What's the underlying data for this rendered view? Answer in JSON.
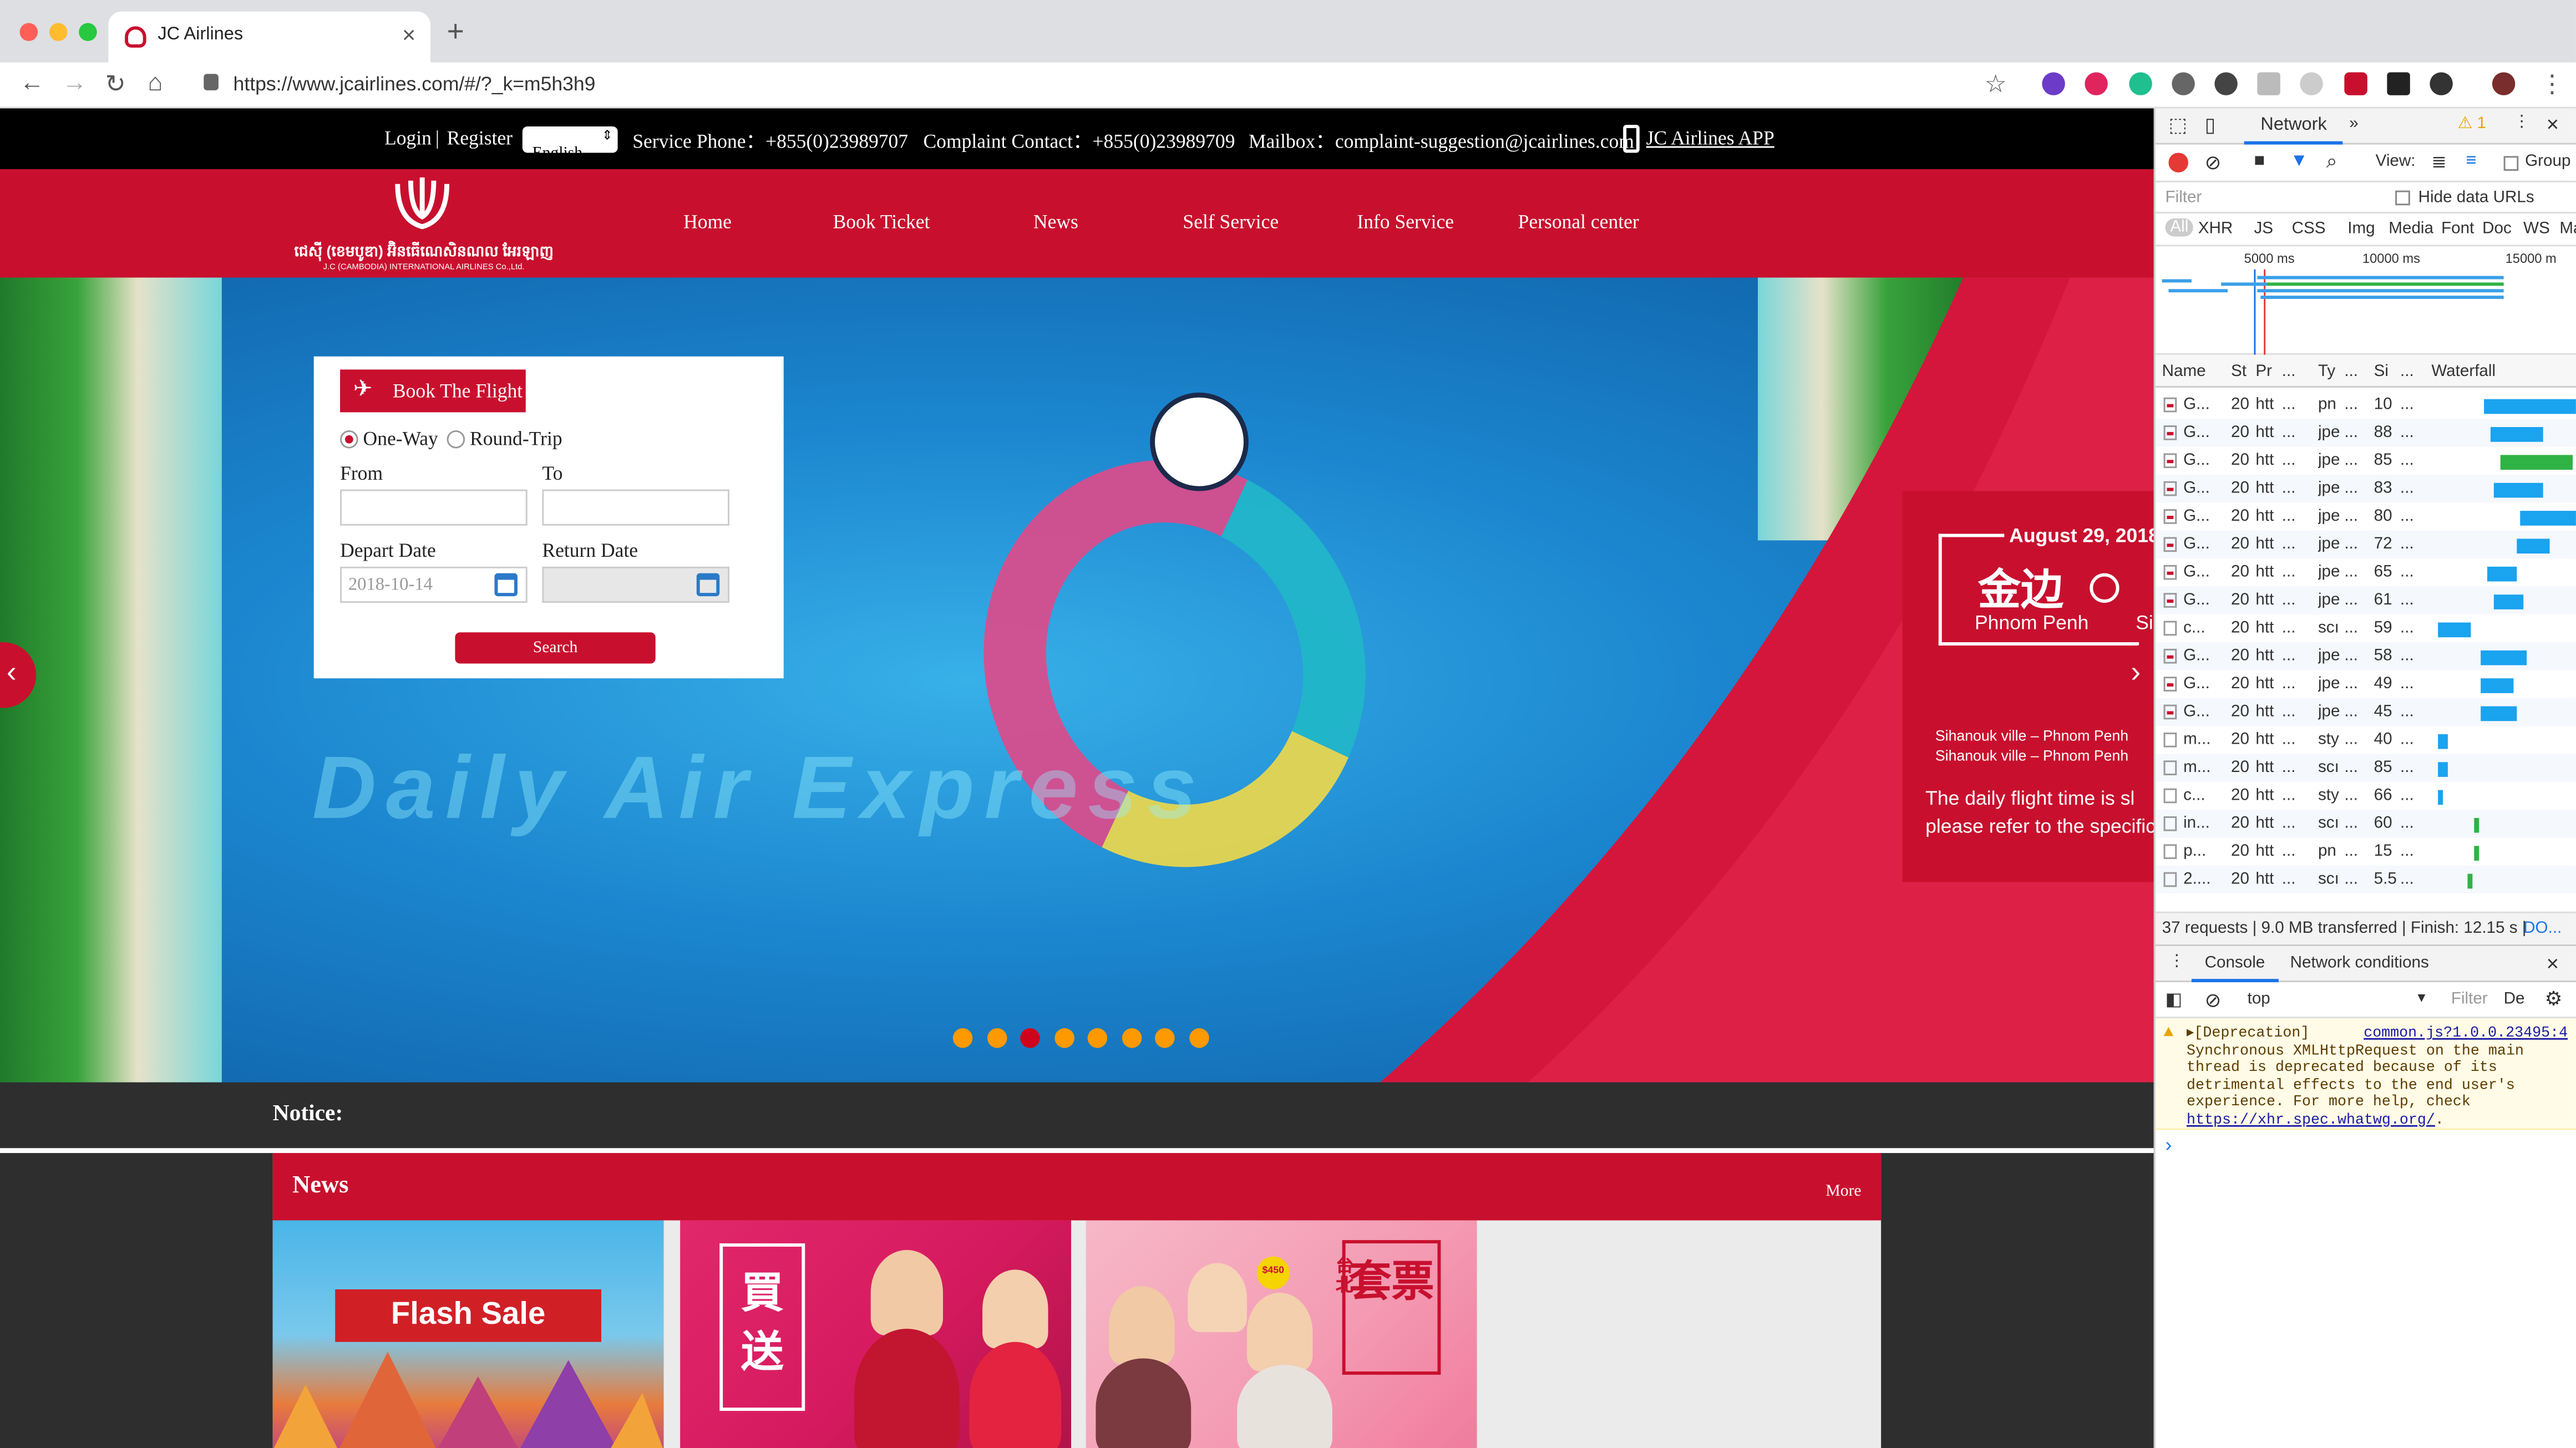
{
  "browser": {
    "tab_title": "JC Airlines",
    "url": "https://www.jcairlines.com/#/?_k=m5h3h9"
  },
  "topbar": {
    "login": "Login",
    "separator": "|",
    "register": "Register",
    "language": "English",
    "service_phone": "Service Phone：+855(0)23989707",
    "complaint_contact": "Complaint Contact：+855(0)23989709",
    "mailbox": "Mailbox：complaint-suggestion@jcairlines.com",
    "app_link": "JC Airlines APP"
  },
  "logo": {
    "khmer_text": "ជេស៊ី (ខេមបូឌា) អ៊ិនធើណេសិនណល អែរឡាញ",
    "subtitle": "J.C (CAMBODIA) INTERNATIONAL AIRLINES Co.,Ltd."
  },
  "nav": [
    "Home",
    "Book Ticket",
    "News",
    "Self Service",
    "Info Service",
    "Personal center"
  ],
  "booking": {
    "tab_label": "Book The Flight",
    "one_way": "One-Way",
    "round_trip": "Round-Trip",
    "from_label": "From",
    "to_label": "To",
    "depart_label": "Depart Date",
    "return_label": "Return Date",
    "depart_value": "2018-10-14",
    "search_label": "Search"
  },
  "banner": {
    "watermark": "Daily Air Express",
    "promo_date": "August 29, 2018",
    "promo_cn": "金边",
    "promo_city": "Phnom Penh",
    "promo_clip": "Si",
    "route1": "Sihanouk ville – Phnom Penh",
    "route2": "Sihanouk ville – Phnom Penh",
    "desc1": "The daily flight time is sl",
    "desc2": "please refer to the specific",
    "dots": 8,
    "active_dot": 2,
    "prev": "‹",
    "next": "›"
  },
  "notice": {
    "label": "Notice:"
  },
  "news": {
    "title": "News",
    "more": "More",
    "card1_text": "Flash Sale",
    "card2_text": "買送",
    "card3_text": "套票",
    "card3_side": "台北",
    "card3_tag": "$450"
  },
  "devtools": {
    "tab_network": "Network",
    "more_tabs": "»",
    "warn_count": "⚠ 1",
    "view_label": "View:",
    "group_label": "Group",
    "filter_placeholder": "Filter",
    "hide_data_urls": "Hide data URLs",
    "types": [
      "All",
      "XHR",
      "JS",
      "CSS",
      "Img",
      "Media",
      "Font",
      "Doc",
      "WS",
      "Man"
    ],
    "ticks": [
      "5000 ms",
      "10000 ms",
      "15000 m"
    ],
    "columns": [
      "Name",
      "St",
      "Pr",
      "...",
      "Ty",
      "...",
      "Si",
      "...",
      "Waterfall"
    ],
    "rows": [
      {
        "name": "G...",
        "st": "20",
        "pr": "htt",
        "ty": "pn",
        "si": "10",
        "img": true
      },
      {
        "name": "G...",
        "st": "20",
        "pr": "htt",
        "ty": "jpe",
        "si": "88",
        "img": true
      },
      {
        "name": "G...",
        "st": "20",
        "pr": "htt",
        "ty": "jpe",
        "si": "85",
        "img": true
      },
      {
        "name": "G...",
        "st": "20",
        "pr": "htt",
        "ty": "jpe",
        "si": "83",
        "img": true
      },
      {
        "name": "G...",
        "st": "20",
        "pr": "htt",
        "ty": "jpe",
        "si": "80",
        "img": true
      },
      {
        "name": "G...",
        "st": "20",
        "pr": "htt",
        "ty": "jpe",
        "si": "72",
        "img": true
      },
      {
        "name": "G...",
        "st": "20",
        "pr": "htt",
        "ty": "jpe",
        "si": "65",
        "img": true
      },
      {
        "name": "G...",
        "st": "20",
        "pr": "htt",
        "ty": "jpe",
        "si": "61",
        "img": true
      },
      {
        "name": "c...",
        "st": "20",
        "pr": "htt",
        "ty": "scı",
        "si": "59",
        "img": false
      },
      {
        "name": "G...",
        "st": "20",
        "pr": "htt",
        "ty": "jpe",
        "si": "58",
        "img": true
      },
      {
        "name": "G...",
        "st": "20",
        "pr": "htt",
        "ty": "jpe",
        "si": "49",
        "img": true
      },
      {
        "name": "G...",
        "st": "20",
        "pr": "htt",
        "ty": "jpe",
        "si": "45",
        "img": true
      },
      {
        "name": "m...",
        "st": "20",
        "pr": "htt",
        "ty": "sty",
        "si": "40",
        "img": false
      },
      {
        "name": "m...",
        "st": "20",
        "pr": "htt",
        "ty": "scı",
        "si": "85",
        "img": false
      },
      {
        "name": "c...",
        "st": "20",
        "pr": "htt",
        "ty": "sty",
        "si": "66",
        "img": false
      },
      {
        "name": "in...",
        "st": "20",
        "pr": "htt",
        "ty": "scı",
        "si": "60",
        "img": false
      },
      {
        "name": "p...",
        "st": "20",
        "pr": "htt",
        "ty": "pn",
        "si": "15",
        "img": false
      },
      {
        "name": "2....",
        "st": "20",
        "pr": "htt",
        "ty": "scı",
        "si": "5.5",
        "img": false
      }
    ],
    "status_text": "37 requests | 9.0 MB transferred | Finish: 12.15 s | ",
    "status_link": "DO...",
    "drawer_console": "Console",
    "drawer_netcond": "Network conditions",
    "context": "top",
    "console_filter": "Filter",
    "console_levels": "De",
    "warn_prefix": "▸[Deprecation]",
    "warn_source": "common.js?1.0.0.23495:4",
    "warn_body": "Synchronous XMLHttpRequest on the main thread is deprecated because of its detrimental effects to the end user's experience. For more help, check ",
    "warn_link": "https://xhr.spec.whatwg.org/",
    "warn_tail": ".",
    "prompt": "›"
  }
}
